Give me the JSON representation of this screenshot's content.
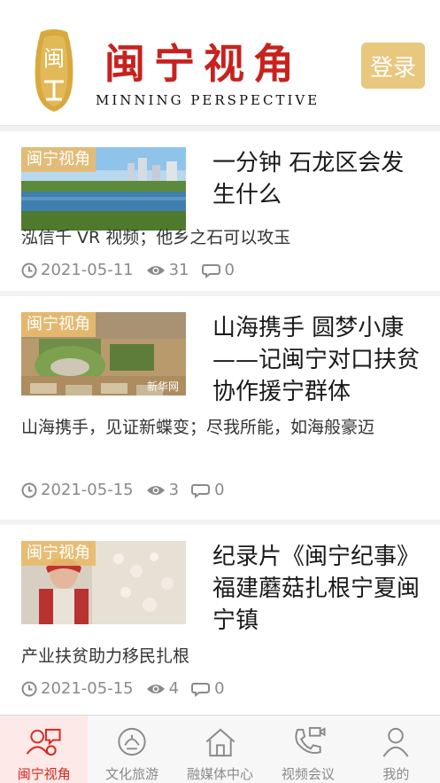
{
  "header": {
    "seal_text": "闽",
    "brand_cn": "闽宁视角",
    "brand_en": "MINNING PERSPECTIVE",
    "login_label": "登录",
    "colors": {
      "brand_red": "#c8221e",
      "gold": "#e8c77e"
    }
  },
  "articles": [
    {
      "tag": "闽宁视角",
      "title": "一分钟 石龙区会发生什么",
      "summary": "泓信千 VR 视频；他乡之石可以攻玉",
      "date": "2021-05-11",
      "views": "31",
      "comments": "0"
    },
    {
      "tag": "闽宁视角",
      "title": "山海携手 圆梦小康——记闽宁对口扶贫协作援宁群体",
      "summary": "山海携手，见证新蝶变；尽我所能，如海般豪迈",
      "watermark": "新华网",
      "date": "2021-05-15",
      "views": "3",
      "comments": "0"
    },
    {
      "tag": "闽宁视角",
      "title": "纪录片《闽宁纪事》 福建蘑菇扎根宁夏闽宁镇",
      "summary": "产业扶贫助力移民扎根",
      "date": "2021-05-15",
      "views": "4",
      "comments": "0"
    }
  ],
  "tabbar": {
    "tabs": [
      {
        "label": "闽宁视角",
        "icon": "people-chat-icon",
        "active": true
      },
      {
        "label": "文化旅游",
        "icon": "culture-emblem-icon",
        "active": false
      },
      {
        "label": "融媒体中心",
        "icon": "home-icon",
        "active": false
      },
      {
        "label": "视频会议",
        "icon": "video-call-icon",
        "active": false
      },
      {
        "label": "我的",
        "icon": "user-icon",
        "active": false
      }
    ],
    "colors": {
      "active": "#d8281f",
      "inactive": "#8a8a8a"
    }
  }
}
